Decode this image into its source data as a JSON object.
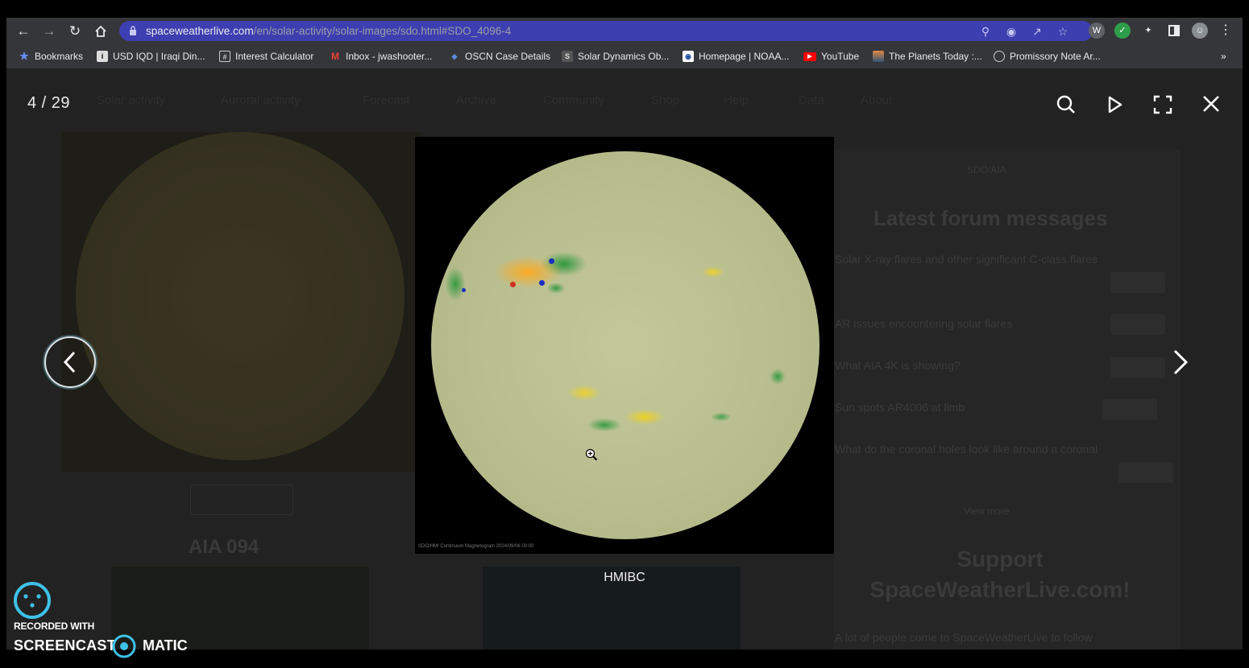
{
  "browser": {
    "url_host": "spaceweatherlive.com",
    "url_path": "/en/solar-activity/solar-images/sdo.html#SDO_4096-4",
    "bookmarks": [
      {
        "label": "Bookmarks",
        "icon": "star-icon"
      },
      {
        "label": "USD IQD | Iraqi Din...",
        "icon": "inv-favicon"
      },
      {
        "label": "Interest Calculator",
        "icon": "calculator-favicon"
      },
      {
        "label": "Inbox - jwashooter...",
        "icon": "gmail-favicon"
      },
      {
        "label": "OSCN Case Details",
        "icon": "oscn-favicon"
      },
      {
        "label": "Solar Dynamics Ob...",
        "icon": "sdo-favicon"
      },
      {
        "label": "Homepage | NOAA...",
        "icon": "noaa-favicon"
      },
      {
        "label": "YouTube",
        "icon": "youtube-favicon"
      },
      {
        "label": "The Planets Today :...",
        "icon": "planets-favicon"
      },
      {
        "label": "Promissory Note Ar...",
        "icon": "globe-favicon"
      }
    ],
    "overflow": "»"
  },
  "background_page": {
    "nav": [
      "Solar activity",
      "Auroral activity",
      "Forecast",
      "Archive",
      "Community",
      "Shop",
      "Help",
      "Data",
      "About"
    ],
    "forum_title": "Latest forum messages",
    "forum_items": [
      "Solar X-ray flares and other significant C-class flares",
      "AR issues encountering solar flares",
      "What AIA 4K is showing?",
      "Sun spots AR4006 at limb",
      "What do the coronal holes look like around a coronal"
    ],
    "view_more": "View more",
    "support_title": "Support SpaceWeatherLive.com!",
    "aia_label": "AIA 094",
    "more_link": "SDO/AIA",
    "support_text": "A lot of people come to SpaceWeatherLive to follow"
  },
  "lightbox": {
    "counter": "4 / 29",
    "caption": "HMIBC",
    "image_credit": "SDO/HMI Continuum Magnetogram 2024/09/06 00:00"
  },
  "watermark": {
    "line1": "RECORDED WITH",
    "line2a": "SCREENCAST",
    "line2b": "MATIC"
  },
  "colors": {
    "omnibox": "#3d3eb0",
    "toolbar": "#35363a",
    "lightbox_bg": "#222222",
    "arrow_ring": "#dde4ea"
  }
}
